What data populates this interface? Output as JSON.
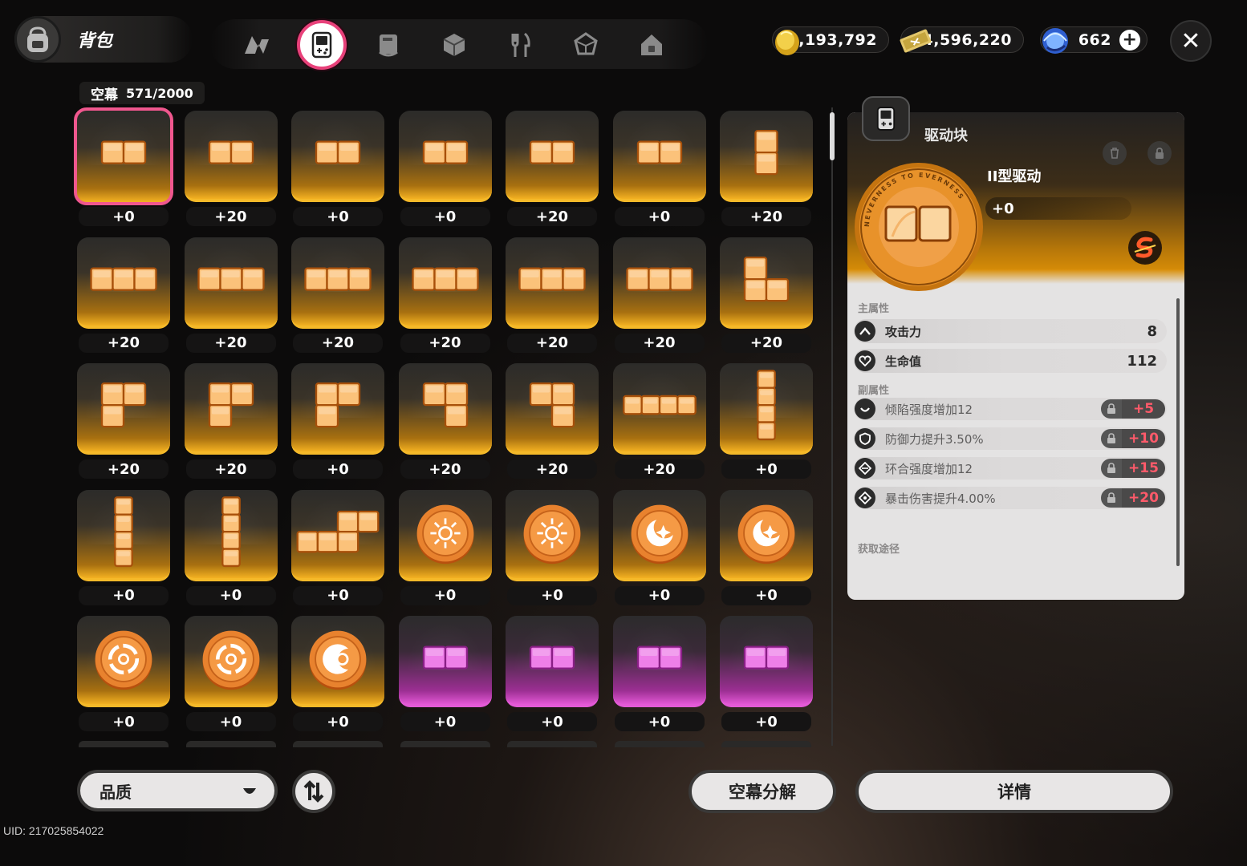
{
  "header": {
    "title": "背包",
    "tabs": [
      {
        "icon": "nevernote-logo-icon",
        "active": false
      },
      {
        "icon": "handheld-console-icon",
        "active": true
      },
      {
        "icon": "book-icon",
        "active": false
      },
      {
        "icon": "cube-icon",
        "active": false
      },
      {
        "icon": "fork-knife-icon",
        "active": false
      },
      {
        "icon": "gem-icon",
        "active": false
      },
      {
        "icon": "house-icon",
        "active": false
      }
    ],
    "currencies": [
      {
        "icon": "gold-coin-icon",
        "value": "1,193,792"
      },
      {
        "icon": "ticket-icon",
        "value": "4,596,220"
      },
      {
        "icon": "blue-orb-icon",
        "value": "662"
      }
    ],
    "close_label": "✕"
  },
  "inventory": {
    "capacity_label": "空幕",
    "capacity_value": "571/2000",
    "items": [
      {
        "shape": "h2",
        "color": "gold",
        "level": "+0",
        "selected": true
      },
      {
        "shape": "h2",
        "color": "gold",
        "level": "+20"
      },
      {
        "shape": "h2",
        "color": "gold",
        "level": "+0"
      },
      {
        "shape": "h2",
        "color": "gold",
        "level": "+0"
      },
      {
        "shape": "h2",
        "color": "gold",
        "level": "+20"
      },
      {
        "shape": "h2",
        "color": "gold",
        "level": "+0"
      },
      {
        "shape": "v2",
        "color": "gold",
        "level": "+20"
      },
      {
        "shape": "h3",
        "color": "gold",
        "level": "+20"
      },
      {
        "shape": "h3",
        "color": "gold",
        "level": "+20"
      },
      {
        "shape": "h3",
        "color": "gold",
        "level": "+20"
      },
      {
        "shape": "h3",
        "color": "gold",
        "level": "+20"
      },
      {
        "shape": "h3",
        "color": "gold",
        "level": "+20"
      },
      {
        "shape": "h3",
        "color": "gold",
        "level": "+20"
      },
      {
        "shape": "L3",
        "color": "gold",
        "level": "+20"
      },
      {
        "shape": "rL",
        "color": "gold",
        "level": "+20"
      },
      {
        "shape": "rL",
        "color": "gold",
        "level": "+20"
      },
      {
        "shape": "rL",
        "color": "gold",
        "level": "+0"
      },
      {
        "shape": "J3",
        "color": "gold",
        "level": "+20"
      },
      {
        "shape": "J3",
        "color": "gold",
        "level": "+20"
      },
      {
        "shape": "h4",
        "color": "gold",
        "level": "+20"
      },
      {
        "shape": "v4",
        "color": "gold",
        "level": "+0"
      },
      {
        "shape": "v4",
        "color": "gold",
        "level": "+0"
      },
      {
        "shape": "v4",
        "color": "gold",
        "level": "+0"
      },
      {
        "shape": "S4",
        "color": "gold",
        "level": "+0"
      },
      {
        "shape": "coin-sun",
        "color": "gold",
        "level": "+0"
      },
      {
        "shape": "coin-sun",
        "color": "gold",
        "level": "+0"
      },
      {
        "shape": "coin-moon",
        "color": "gold",
        "level": "+0"
      },
      {
        "shape": "coin-moon",
        "color": "gold",
        "level": "+0"
      },
      {
        "shape": "coin-ring",
        "color": "gold",
        "level": "+0"
      },
      {
        "shape": "coin-ring",
        "color": "gold",
        "level": "+0"
      },
      {
        "shape": "coin-crescent",
        "color": "gold",
        "level": "+0"
      },
      {
        "shape": "h2",
        "color": "purple",
        "level": "+0"
      },
      {
        "shape": "h2",
        "color": "purple",
        "level": "+0"
      },
      {
        "shape": "h2",
        "color": "purple",
        "level": "+0"
      },
      {
        "shape": "h2",
        "color": "purple",
        "level": "+0"
      }
    ]
  },
  "detail": {
    "type_label": "驱动块",
    "name": "II型驱动",
    "level": "+0",
    "medal_text": "NEVERNESS TO EVERNESS",
    "main_section": "主属性",
    "main_stats": [
      {
        "icon": "attack-chevron-icon",
        "name": "攻击力",
        "value": "8"
      },
      {
        "icon": "heart-icon",
        "name": "生命值",
        "value": "112"
      }
    ],
    "sub_section": "副属性",
    "sub_stats": [
      {
        "icon": "smile-arc-icon",
        "name": "倾陷强度增加12",
        "level": "+5"
      },
      {
        "icon": "shield-icon",
        "name": "防御力提升3.50%",
        "level": "+10"
      },
      {
        "icon": "ring-diamond-icon",
        "name": "环合强度增加12",
        "level": "+15"
      },
      {
        "icon": "crit-diamond-icon",
        "name": "暴击伤害提升4.00%",
        "level": "+20"
      }
    ],
    "source_section": "获取途径"
  },
  "footer": {
    "quality_label": "品质",
    "decompose_label": "空幕分解",
    "details_label": "详情",
    "uid": "UID: 217025854022"
  },
  "colors": {
    "gold": "#f5b929",
    "purple": "#e35ad6",
    "accent_pink": "#e8417a",
    "sub_level_red": "#ff5a6a"
  }
}
